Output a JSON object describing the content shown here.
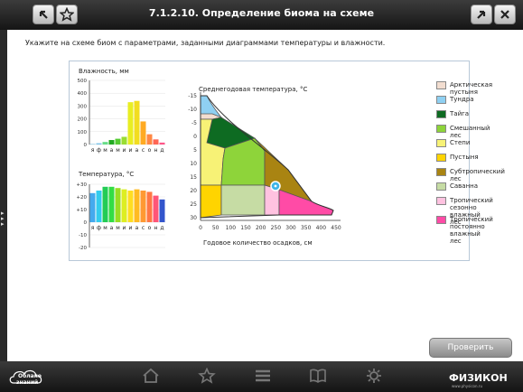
{
  "header": {
    "title": "7.1.2.10. Определение биома на схеме"
  },
  "instruction": "Укажите на схеме биом с параметрами, заданными диаграммами температуры и влажности.",
  "humidity_chart": {
    "title": "Влажность, мм",
    "y_ticks": [
      "500",
      "400",
      "300",
      "200",
      "100",
      "0"
    ],
    "months": [
      "я",
      "ф",
      "м",
      "а",
      "м",
      "и",
      "и",
      "а",
      "с",
      "о",
      "н",
      "д"
    ],
    "values": [
      5,
      10,
      20,
      35,
      45,
      60,
      330,
      340,
      180,
      80,
      40,
      15
    ],
    "colors": [
      "#9ad0e8",
      "#7cc4ea",
      "#66dd88",
      "#22aa22",
      "#55cc33",
      "#99dd33",
      "#e8ee22",
      "#f2dd20",
      "#ffaa22",
      "#ff8844",
      "#ff6655",
      "#ff5588"
    ]
  },
  "temperature_chart": {
    "title": "Температура, °С",
    "y_ticks": [
      "+30",
      "+20",
      "+10",
      "0",
      "-10",
      "-20"
    ],
    "months": [
      "я",
      "ф",
      "м",
      "а",
      "м",
      "и",
      "и",
      "а",
      "с",
      "о",
      "н",
      "д"
    ],
    "values": [
      23,
      25,
      28,
      28,
      27,
      26,
      25,
      26,
      25,
      24,
      21,
      18
    ],
    "colors": [
      "#44aaee",
      "#33ccee",
      "#22cc55",
      "#33dd44",
      "#99dd22",
      "#ddee22",
      "#ffdd22",
      "#ffbb22",
      "#ff9933",
      "#ff7744",
      "#ff5577",
      "#3355cc"
    ]
  },
  "diagram": {
    "title": "Среднегодовая температура, °С",
    "xlabel": "Годовое количество осадков, см",
    "y_ticks": [
      "-15",
      "-10",
      "-5",
      "0",
      "5",
      "10",
      "15",
      "20",
      "25",
      "30"
    ],
    "x_ticks": [
      "0",
      "50",
      "100",
      "150",
      "200",
      "250",
      "300",
      "350",
      "400",
      "450"
    ],
    "marker": {
      "precip_cm": 250,
      "temp_c": 20
    }
  },
  "legend": [
    {
      "label": "Арктическая пустыня",
      "color": "#f2ddd0"
    },
    {
      "label": "Тундра",
      "color": "#8fd0f2"
    },
    {
      "label": "Тайга",
      "color": "#0e6b22"
    },
    {
      "label": "Смешанный лес",
      "color": "#8ed43a"
    },
    {
      "label": "Степи",
      "color": "#f7f276"
    },
    {
      "label": "Пустыня",
      "color": "#ffd400"
    },
    {
      "label": "Субтропический лес",
      "color": "#a98412"
    },
    {
      "label": "Саванна",
      "color": "#c6dca4"
    },
    {
      "label": "Тропический сезонно влажный лес",
      "color": "#ffc2e0"
    },
    {
      "label": "Тропический постоянно влажный лес",
      "color": "#ff4ba6"
    }
  ],
  "buttons": {
    "check": "Проверить"
  },
  "brand": {
    "name": "ФИЗИКОН",
    "site": "www.physicon.ru",
    "logo_line1": "Облако",
    "logo_line2": "знаний"
  }
}
